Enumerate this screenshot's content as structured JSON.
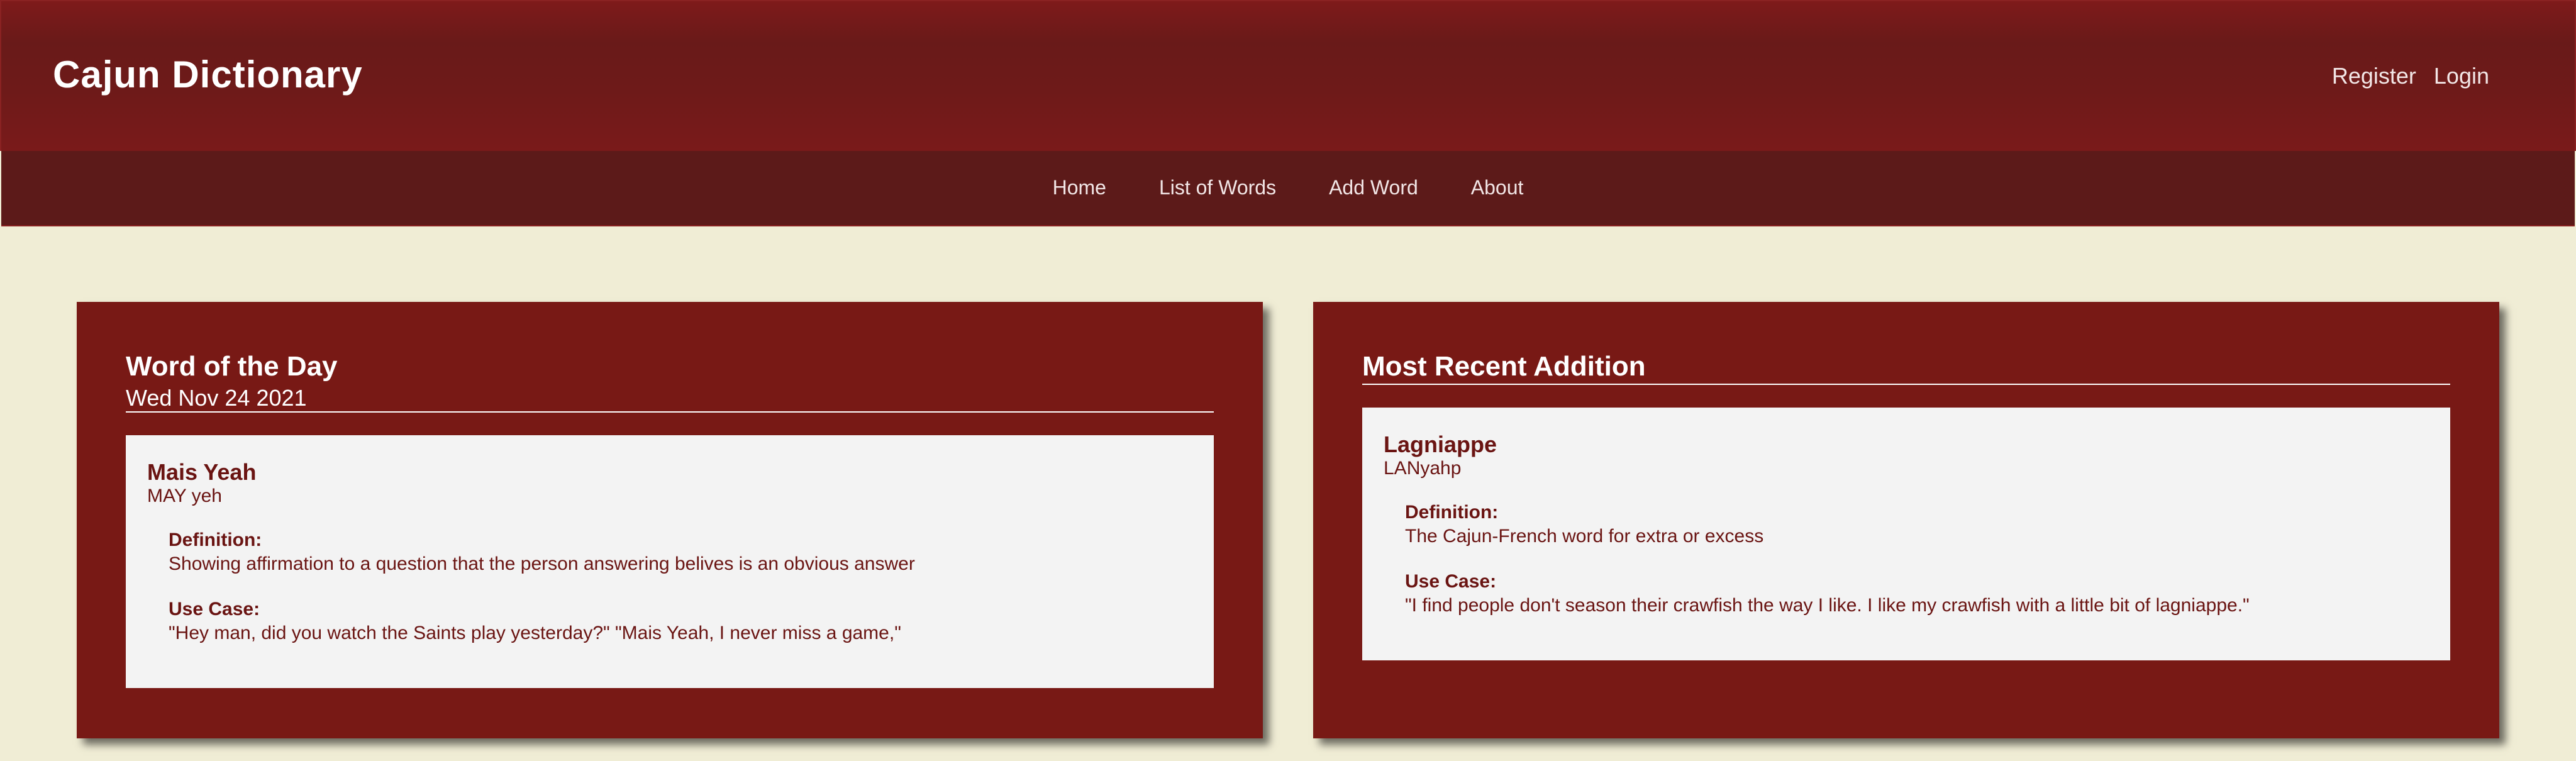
{
  "header": {
    "brand": "Cajun Dictionary",
    "auth": {
      "register": "Register",
      "login": "Login"
    }
  },
  "nav": {
    "items": [
      "Home",
      "List of Words",
      "Add Word",
      "About"
    ]
  },
  "word_of_day": {
    "title": "Word of the Day",
    "date": "Wed Nov 24 2021",
    "word": "Mais Yeah",
    "pronunciation": "MAY yeh",
    "definition_label": "Definition:",
    "definition": "Showing affirmation to a question that the person answering belives is an obvious answer",
    "use_case_label": "Use Case:",
    "use_case": "\"Hey man, did you watch the Saints play yesterday?\" \"Mais Yeah, I never miss a game,\""
  },
  "recent": {
    "title": "Most Recent Addition",
    "word": "Lagniappe",
    "pronunciation": "LANyahp",
    "definition_label": "Definition:",
    "definition": "The Cajun-French word for extra or excess",
    "use_case_label": "Use Case:",
    "use_case": "\"I find people don't season their crawfish the way I like. I like my crawfish with a little bit of lagniappe.\""
  },
  "colors": {
    "header": "#6e1a19",
    "navbar": "#5c1a19",
    "card": "#781915",
    "page_bg": "#f0edd5",
    "text_dark_red": "#6a1412"
  }
}
